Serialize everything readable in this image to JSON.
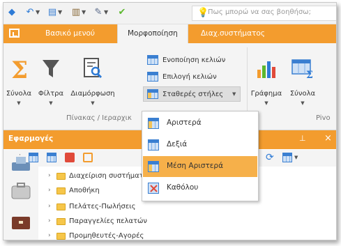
{
  "quick_access": {
    "icons": [
      "app-icon",
      "back-icon",
      "view-icon",
      "columns-icon",
      "format-painter-icon",
      "check-icon"
    ],
    "tell_me_placeholder": "Πως μπορώ να σας βοηθήσω;"
  },
  "tabs": [
    {
      "label": "Βασικό μενού"
    },
    {
      "label": "Μορφοποίηση"
    },
    {
      "label": "Διαχ.συστήματος"
    }
  ],
  "ribbon": {
    "sum_label": "Σύνολα",
    "filter_label": "Φίλτρα",
    "format_label": "Διαμόρφωση",
    "merge_cells_label": "Ενοποίηση κελιών",
    "select_cells_label": "Επιλογή κελιών",
    "fixed_columns_label": "Σταθερές στήλες",
    "chart_label": "Γράφημα",
    "sums_label_2": "Σύνολα",
    "group_label": "Πίνακας / Ιεραρχικ",
    "group_label_2": "Pivo"
  },
  "dropdown": {
    "items": [
      {
        "label": "Αριστερά"
      },
      {
        "label": "Δεξιά"
      },
      {
        "label": "Μέση Αριστερά"
      },
      {
        "label": "Καθόλου"
      }
    ],
    "highlighted_index": 2
  },
  "pane": {
    "title": "Εφαρμογές",
    "pin_glyph": "⊥",
    "close_glyph": "×"
  },
  "tree": {
    "items": [
      {
        "label": "Διαχείριση συστήματ"
      },
      {
        "label": "Αποθήκη"
      },
      {
        "label": "Πελάτες-Πωλήσεις"
      },
      {
        "label": "Παραγγελίες πελατών"
      },
      {
        "label": "Προμηθευτές-Αγορές"
      }
    ]
  },
  "colors": {
    "accent": "#f39c2e",
    "highlight": "#f6b04a"
  }
}
